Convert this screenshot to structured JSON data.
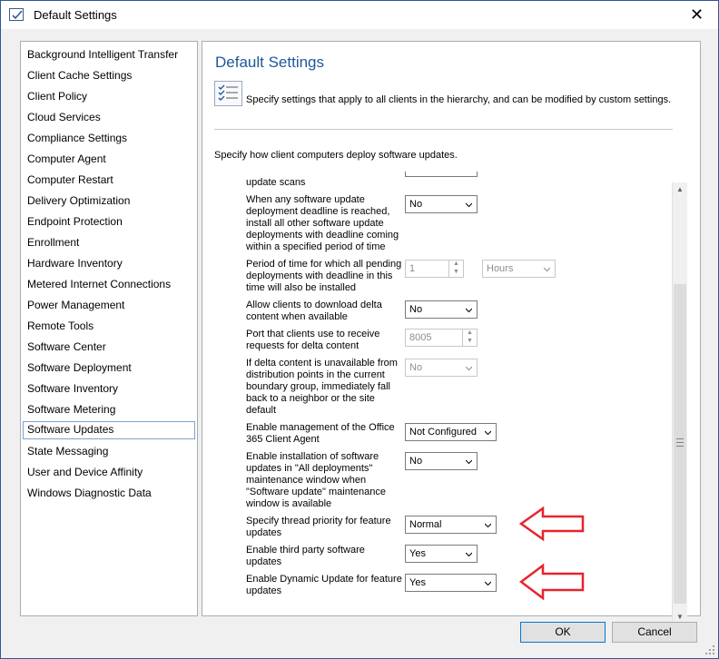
{
  "window": {
    "title": "Default Settings",
    "close_label": "✕"
  },
  "sidebar": {
    "items": [
      {
        "label": "Background Intelligent Transfer"
      },
      {
        "label": "Client Cache Settings"
      },
      {
        "label": "Client Policy"
      },
      {
        "label": "Cloud Services"
      },
      {
        "label": "Compliance Settings"
      },
      {
        "label": "Computer Agent"
      },
      {
        "label": "Computer Restart"
      },
      {
        "label": "Delivery Optimization"
      },
      {
        "label": "Endpoint Protection"
      },
      {
        "label": "Enrollment"
      },
      {
        "label": "Hardware Inventory"
      },
      {
        "label": "Metered Internet Connections"
      },
      {
        "label": "Power Management"
      },
      {
        "label": "Remote Tools"
      },
      {
        "label": "Software Center"
      },
      {
        "label": "Software Deployment"
      },
      {
        "label": "Software Inventory"
      },
      {
        "label": "Software Metering"
      },
      {
        "label": "Software Updates"
      },
      {
        "label": "State Messaging"
      },
      {
        "label": "User and Device Affinity"
      },
      {
        "label": "Windows Diagnostic Data"
      }
    ],
    "selected": "Software Updates"
  },
  "main": {
    "title": "Default Settings",
    "description": "Specify settings that apply to all clients in the hierarchy, and can be modified by custom settings.",
    "section_text": "Specify how client computers deploy software updates.",
    "settings": {
      "partial_label": "update scans",
      "deadline_label": "When any software update deployment deadline is reached, install all other software update deployments with deadline coming within a specified period of time",
      "deadline_value": "No",
      "period_label": "Period of time for which all pending deployments with deadline in this time will also be installed",
      "period_value": "1",
      "period_unit": "Hours",
      "delta_download_label": "Allow clients to download delta content when available",
      "delta_download_value": "No",
      "delta_port_label": "Port that clients use to receive requests for delta content",
      "delta_port_value": "8005",
      "delta_fallback_label": "If delta content is unavailable from distribution points in the current boundary group, immediately fall back to a neighbor or the site default",
      "delta_fallback_value": "No",
      "office_label": "Enable management of the Office 365 Client Agent",
      "office_value": "Not Configured",
      "maintenance_label": "Enable installation of software updates in \"All deployments\" maintenance window when \"Software update\" maintenance window is available",
      "maintenance_value": "No",
      "thread_label": "Specify thread priority for feature updates",
      "thread_value": "Normal",
      "third_party_label": "Enable third party software updates",
      "third_party_value": "Yes",
      "dynamic_label": "Enable Dynamic Update for feature updates",
      "dynamic_value": "Yes"
    }
  },
  "footer": {
    "ok_label": "OK",
    "cancel_label": "Cancel"
  },
  "colors": {
    "accent": "#1e5799",
    "annotation_arrow": "#e8242c"
  },
  "icons": {
    "app": "settings-checklist-icon",
    "description": "checklist-icon",
    "annotation": "red-arrow-icon"
  }
}
